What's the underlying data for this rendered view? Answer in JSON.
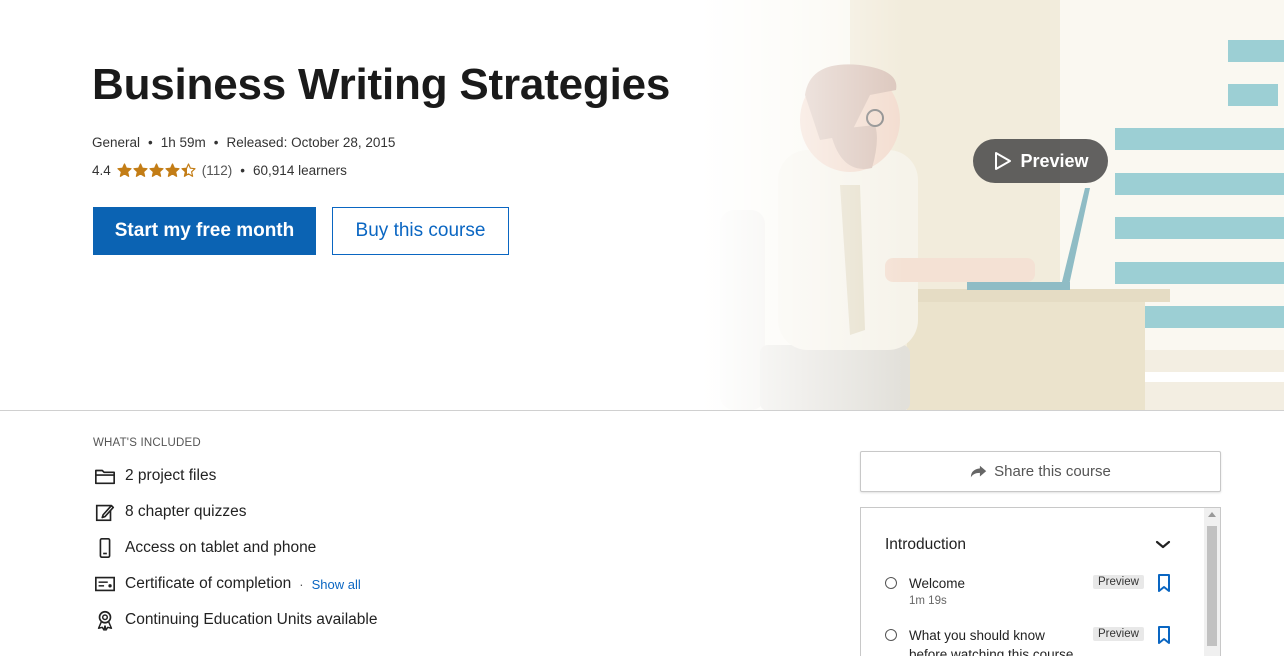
{
  "course": {
    "title": "Business Writing Strategies",
    "level": "General",
    "duration": "1h 59m",
    "released": "Released: October 28, 2015",
    "rating": "4.4",
    "rating_value": 4.4,
    "reviews": "(112)",
    "learners": "60,914 learners"
  },
  "buttons": {
    "start": "Start my free month",
    "buy": "Buy this course",
    "preview": "Preview",
    "share": "Share this course"
  },
  "included": {
    "heading": "WHAT'S INCLUDED",
    "items": [
      {
        "icon": "folder-icon",
        "label": "2 project files"
      },
      {
        "icon": "quiz-icon",
        "label": "8 chapter quizzes"
      },
      {
        "icon": "phone-icon",
        "label": "Access on tablet and phone"
      },
      {
        "icon": "certificate-icon",
        "label": "Certificate of completion"
      },
      {
        "icon": "ribbon-icon",
        "label": "Continuing Education Units available"
      }
    ],
    "show_all": "Show all"
  },
  "toc": {
    "chapter": "Introduction",
    "lessons": [
      {
        "name": "Welcome",
        "duration": "1m 19s",
        "tag": "Preview"
      },
      {
        "name": "What you should know before watching this course",
        "duration": "",
        "tag": "Preview"
      }
    ]
  },
  "colors": {
    "primary": "#0a66c2",
    "star": "#c37d16",
    "preview_overlay": "#464646"
  }
}
